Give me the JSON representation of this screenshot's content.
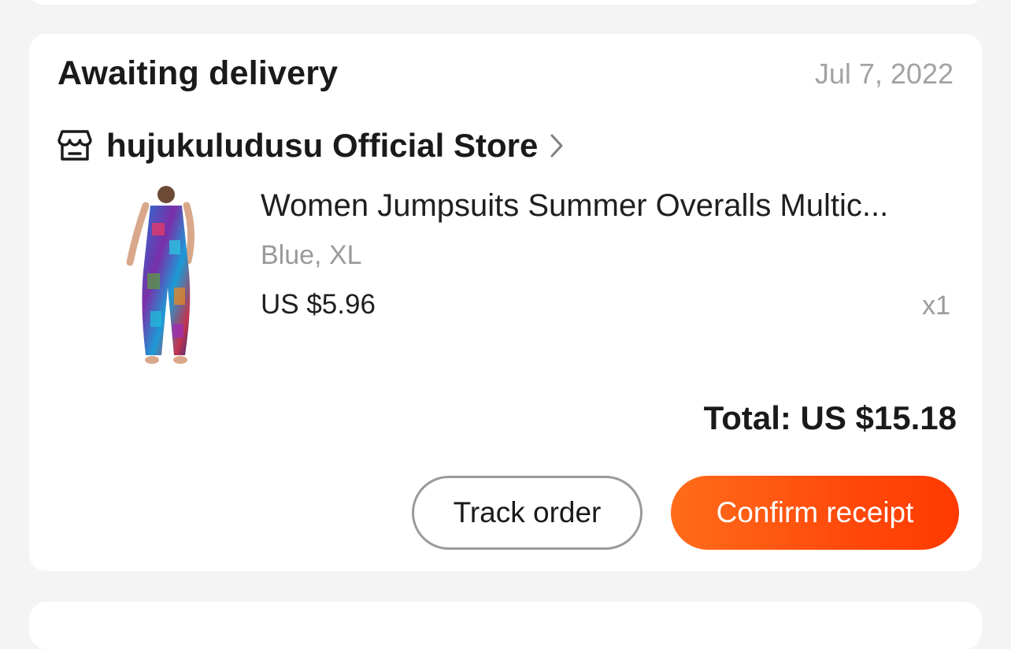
{
  "order": {
    "status": "Awaiting delivery",
    "date": "Jul 7, 2022",
    "store": {
      "name": "hujukuludusu Official Store",
      "icon": "store-icon",
      "chevron": "chevron-right-icon"
    },
    "item": {
      "title": "Women Jumpsuits Summer Overalls Multic...",
      "variant": "Blue, XL",
      "price": "US $5.96",
      "quantity": "x1"
    },
    "total": "Total: US $15.18",
    "buttons": {
      "track": "Track order",
      "confirm": "Confirm receipt"
    }
  },
  "colors": {
    "accent": "#ff4a0c",
    "background": "#f4f4f4",
    "card": "#ffffff",
    "muted_text": "#9a9a9a"
  }
}
